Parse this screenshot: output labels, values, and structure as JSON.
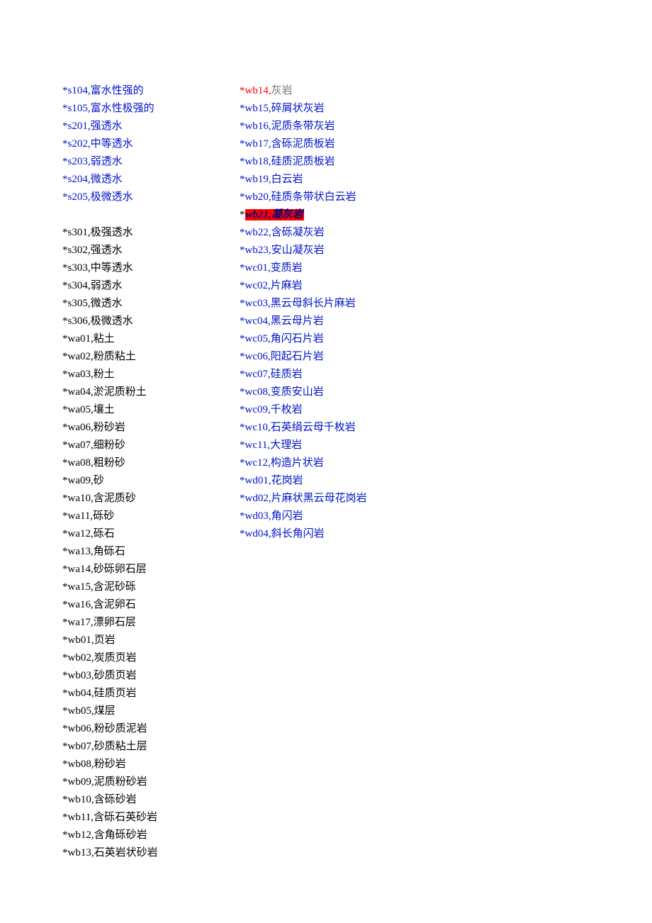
{
  "columnA": [
    {
      "code": "*s104,",
      "label": "富水性强的",
      "style": "blue"
    },
    {
      "code": "*s105,",
      "label": "富水性极强的",
      "style": "blue"
    },
    {
      "code": "*s201,",
      "label": "强透水",
      "style": "blue"
    },
    {
      "code": "*s202,",
      "label": "中等透水",
      "style": "blue"
    },
    {
      "code": "*s203,",
      "label": "弱透水",
      "style": "blue"
    },
    {
      "code": "*s204,",
      "label": "微透水",
      "style": "blue"
    },
    {
      "code": "*s205,",
      "label": "极微透水",
      "style": "blue"
    },
    {
      "blank": true
    },
    {
      "code": "*s301,",
      "label": "极强透水",
      "style": "black"
    },
    {
      "code": "*s302,",
      "label": "强透水",
      "style": "black"
    },
    {
      "code": "*s303,",
      "label": "中等透水",
      "style": "black"
    },
    {
      "code": "*s304,",
      "label": "弱透水",
      "style": "black"
    },
    {
      "code": "*s305,",
      "label": "微透水",
      "style": "black"
    },
    {
      "code": "*s306,",
      "label": "极微透水",
      "style": "black"
    },
    {
      "code": "*wa01,",
      "label": "粘土",
      "style": "black"
    },
    {
      "code": "*wa02,",
      "label": "粉质粘土",
      "style": "black"
    },
    {
      "code": "*wa03,",
      "label": "粉土",
      "style": "black"
    },
    {
      "code": "*wa04,",
      "label": "淤泥质粉土",
      "style": "black"
    },
    {
      "code": "*wa05,",
      "label": "壤土",
      "style": "black"
    },
    {
      "code": "*wa06,",
      "label": "粉砂岩",
      "style": "black"
    },
    {
      "code": "*wa07,",
      "label": "细粉砂",
      "style": "black"
    },
    {
      "code": "*wa08,",
      "label": "粗粉砂",
      "style": "black"
    },
    {
      "code": "*wa09,",
      "label": "砂",
      "style": "black"
    },
    {
      "code": "*wa10,",
      "label": "含泥质砂",
      "style": "black"
    },
    {
      "code": "*wa11,",
      "label": "砾砂",
      "style": "black"
    },
    {
      "code": "*wa12,",
      "label": "砾石",
      "style": "black"
    },
    {
      "code": "*wa13,",
      "label": "角砾石",
      "style": "black"
    },
    {
      "code": "*wa14,",
      "label": "砂砾卵石层",
      "style": "black"
    },
    {
      "code": "*wa15,",
      "label": "含泥砂砾",
      "style": "black"
    },
    {
      "code": "*wa16,",
      "label": "含泥卵石",
      "style": "black"
    },
    {
      "code": "*wa17,",
      "label": "漂卵石层",
      "style": "black"
    },
    {
      "code": "*wb01,",
      "label": "页岩",
      "style": "black"
    },
    {
      "code": "*wb02,",
      "label": "炭质页岩",
      "style": "black"
    },
    {
      "code": "*wb03,",
      "label": "砂质页岩",
      "style": "black"
    },
    {
      "code": "*wb04,",
      "label": "硅质页岩",
      "style": "black"
    },
    {
      "code": "*wb05,",
      "label": "煤层",
      "style": "black"
    },
    {
      "code": "*wb06,",
      "label": "粉砂质泥岩",
      "style": "black"
    },
    {
      "code": "*wb07,",
      "label": "砂质粘土层",
      "style": "black"
    },
    {
      "code": "*wb08,",
      "label": "粉砂岩",
      "style": "black"
    },
    {
      "code": "*wb09,",
      "label": "泥质粉砂岩",
      "style": "black"
    },
    {
      "code": "*wb10,",
      "label": "含砾砂岩",
      "style": "black"
    },
    {
      "code": "*wb11,",
      "label": "含砾石英砂岩",
      "style": "black"
    },
    {
      "code": "*wb12,",
      "label": "含角砾砂岩",
      "style": "black"
    },
    {
      "code": "*wb13,",
      "label": "石英岩状砂岩",
      "style": "black"
    }
  ],
  "columnB": [
    {
      "code": "*wb14,",
      "label": "灰岩",
      "style": "wb14"
    },
    {
      "code": "*wb15,",
      "label": "碎屑状灰岩",
      "style": "blue"
    },
    {
      "code": "*wb16,",
      "label": "泥质条带灰岩",
      "style": "blue"
    },
    {
      "code": "*wb17,",
      "label": "含砾泥质板岩",
      "style": "blue"
    },
    {
      "code": "*wb18,",
      "label": "硅质泥质板岩",
      "style": "blue"
    },
    {
      "code": "*wb19,",
      "label": "白云岩",
      "style": "blue"
    },
    {
      "code": "*wb20,",
      "label": "硅质条带状白云岩",
      "style": "blue"
    },
    {
      "highlight": true,
      "code": "*",
      "hl_text": "wb21,凝灰岩"
    },
    {
      "code": "*wb22,",
      "label": "含砾凝灰岩",
      "style": "blue"
    },
    {
      "code": "*wb23,",
      "label": "安山凝灰岩",
      "style": "blue"
    },
    {
      "code": "*wc01,",
      "label": "变质岩",
      "style": "blue"
    },
    {
      "code": "*wc02,",
      "label": "片麻岩",
      "style": "blue"
    },
    {
      "code": "*wc03,",
      "label": "黑云母斜长片麻岩",
      "style": "blue"
    },
    {
      "code": "*wc04,",
      "label": "黑云母片岩",
      "style": "blue"
    },
    {
      "code": "*wc05,",
      "label": "角闪石片岩",
      "style": "blue"
    },
    {
      "code": "*wc06,",
      "label": "阳起石片岩",
      "style": "blue"
    },
    {
      "code": "*wc07,",
      "label": "硅质岩",
      "style": "blue"
    },
    {
      "code": "*wc08,",
      "label": "变质安山岩",
      "style": "blue"
    },
    {
      "code": "*wc09,",
      "label": "千枚岩",
      "style": "blue"
    },
    {
      "code": "*wc10,",
      "label": "石英绢云母千枚岩",
      "style": "blue"
    },
    {
      "code": "*wc11,",
      "label": "大理岩",
      "style": "blue"
    },
    {
      "code": "*wc12,",
      "label": "构造片状岩",
      "style": "blue"
    },
    {
      "code": "*wd01,",
      "label": "花岗岩",
      "style": "blue"
    },
    {
      "code": "*wd02,",
      "label": "片麻状黑云母花岗岩",
      "style": "blue"
    },
    {
      "code": "*wd03,",
      "label": "角闪岩",
      "style": "blue"
    },
    {
      "code": "*wd04,",
      "label": "斜长角闪岩",
      "style": "blue"
    }
  ]
}
